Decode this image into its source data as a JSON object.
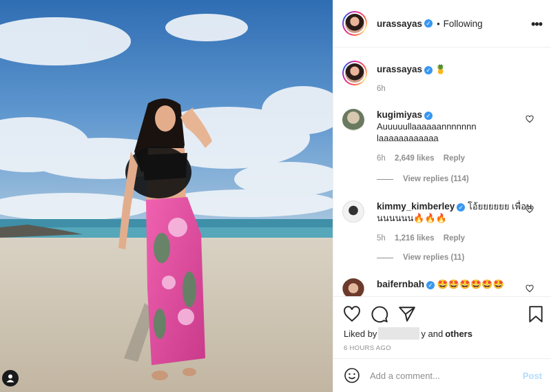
{
  "photo": {
    "user_badge_icon": "person-icon",
    "sky_color": "#4a86c8",
    "sea_color": "#3f8fa8",
    "sand_color": "#cfc4b2",
    "sarong_color": "#e0489a"
  },
  "header": {
    "username": "urassayas",
    "verified_icon": "verified-badge-icon",
    "separator": "•",
    "follow_status": "Following",
    "more_label": "•••"
  },
  "caption": {
    "username": "urassayas",
    "emoji": "🍍",
    "time": "6h"
  },
  "comments": [
    {
      "username": "kugimiyas",
      "text": "Auuuuullaaaaaannnnnnn laaaaaaaaaaaa",
      "time": "6h",
      "likes": "2,649 likes",
      "reply": "Reply",
      "view_replies": "View replies (114)"
    },
    {
      "username": "kimmy_kimberley",
      "text": "โอ้ยยยยยย เพื่อนนนนนนน🔥🔥🔥",
      "time": "5h",
      "likes": "1,216 likes",
      "reply": "Reply",
      "view_replies": "View replies (11)"
    },
    {
      "username": "baifernbah",
      "text": "🤩🤩🤩🤩🤩🤩"
    }
  ],
  "actions": {
    "icons": [
      "heart-icon",
      "comment-icon",
      "share-icon",
      "bookmark-icon"
    ],
    "liked_prefix": "Liked by",
    "liked_suffix": "y and",
    "liked_others": "others",
    "timestamp": "6 HOURS AGO"
  },
  "add_comment": {
    "placeholder": "Add a comment...",
    "post_label": "Post"
  }
}
